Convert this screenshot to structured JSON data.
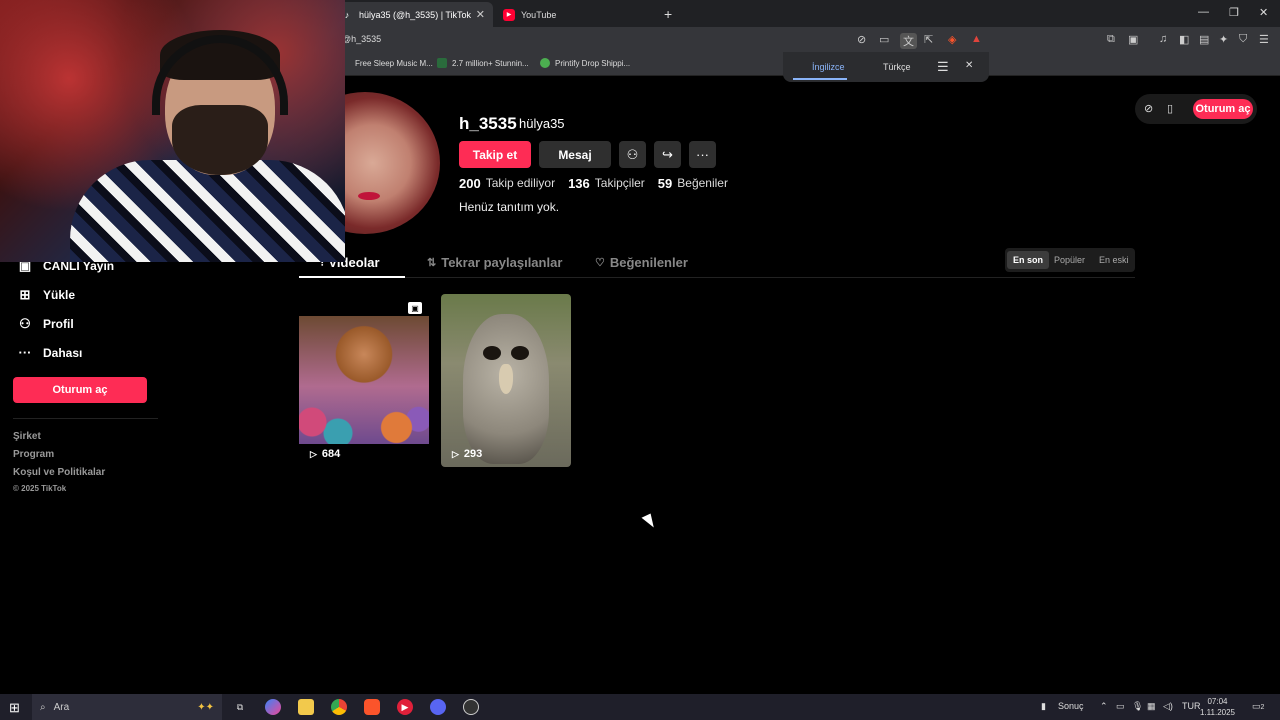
{
  "browser": {
    "tabs": [
      {
        "label": "hülya35 (@h_3535) | TikTok",
        "active": true
      },
      {
        "label": "YouTube",
        "active": false
      }
    ],
    "url": "@h_3535",
    "bookmarks": [
      "Free Sleep Music M...",
      "2.7 million+ Stunnin...",
      "Printify Drop Shippi..."
    ],
    "translate": {
      "option1": "İngilizce",
      "option2": "Türkçe"
    }
  },
  "profile": {
    "username": "h_3535",
    "nickname": "hülya35",
    "follow_label": "Takip et",
    "message_label": "Mesaj",
    "stats": {
      "following_count": "200",
      "following_label": "Takip ediliyor",
      "followers_count": "136",
      "followers_label": "Takipçiler",
      "likes_count": "59",
      "likes_label": "Beğeniler"
    },
    "bio": "Henüz tanıtım yok."
  },
  "tabs": {
    "videos": "Videolar",
    "reposts": "Tekrar paylaşılanlar",
    "liked": "Beğenilenler"
  },
  "sort": {
    "newest": "En son",
    "popular": "Popüler",
    "oldest": "En eski",
    "selected": "En son"
  },
  "topright": {
    "login": "Oturum aç"
  },
  "sidebar": {
    "items": [
      {
        "label": "CANLI Yayın",
        "icon": "live-icon"
      },
      {
        "label": "Yükle",
        "icon": "upload-icon"
      },
      {
        "label": "Profil",
        "icon": "user-icon"
      },
      {
        "label": "Dahası",
        "icon": "more-icon"
      }
    ],
    "login": "Oturum aç",
    "footer": [
      "Şirket",
      "Program",
      "Koşul ve Politikalar"
    ],
    "copyright": "© 2025 TikTok"
  },
  "videos": [
    {
      "views": "684",
      "pinned": true
    },
    {
      "views": "293",
      "pinned": false
    }
  ],
  "taskbar": {
    "search_placeholder": "Ara",
    "weather": "Sonuç",
    "lang": "TUR",
    "time": "07:04",
    "date": "1.11.2025",
    "notifications": "2"
  },
  "colors": {
    "brand": "#fe2c55",
    "background": "#000000"
  }
}
